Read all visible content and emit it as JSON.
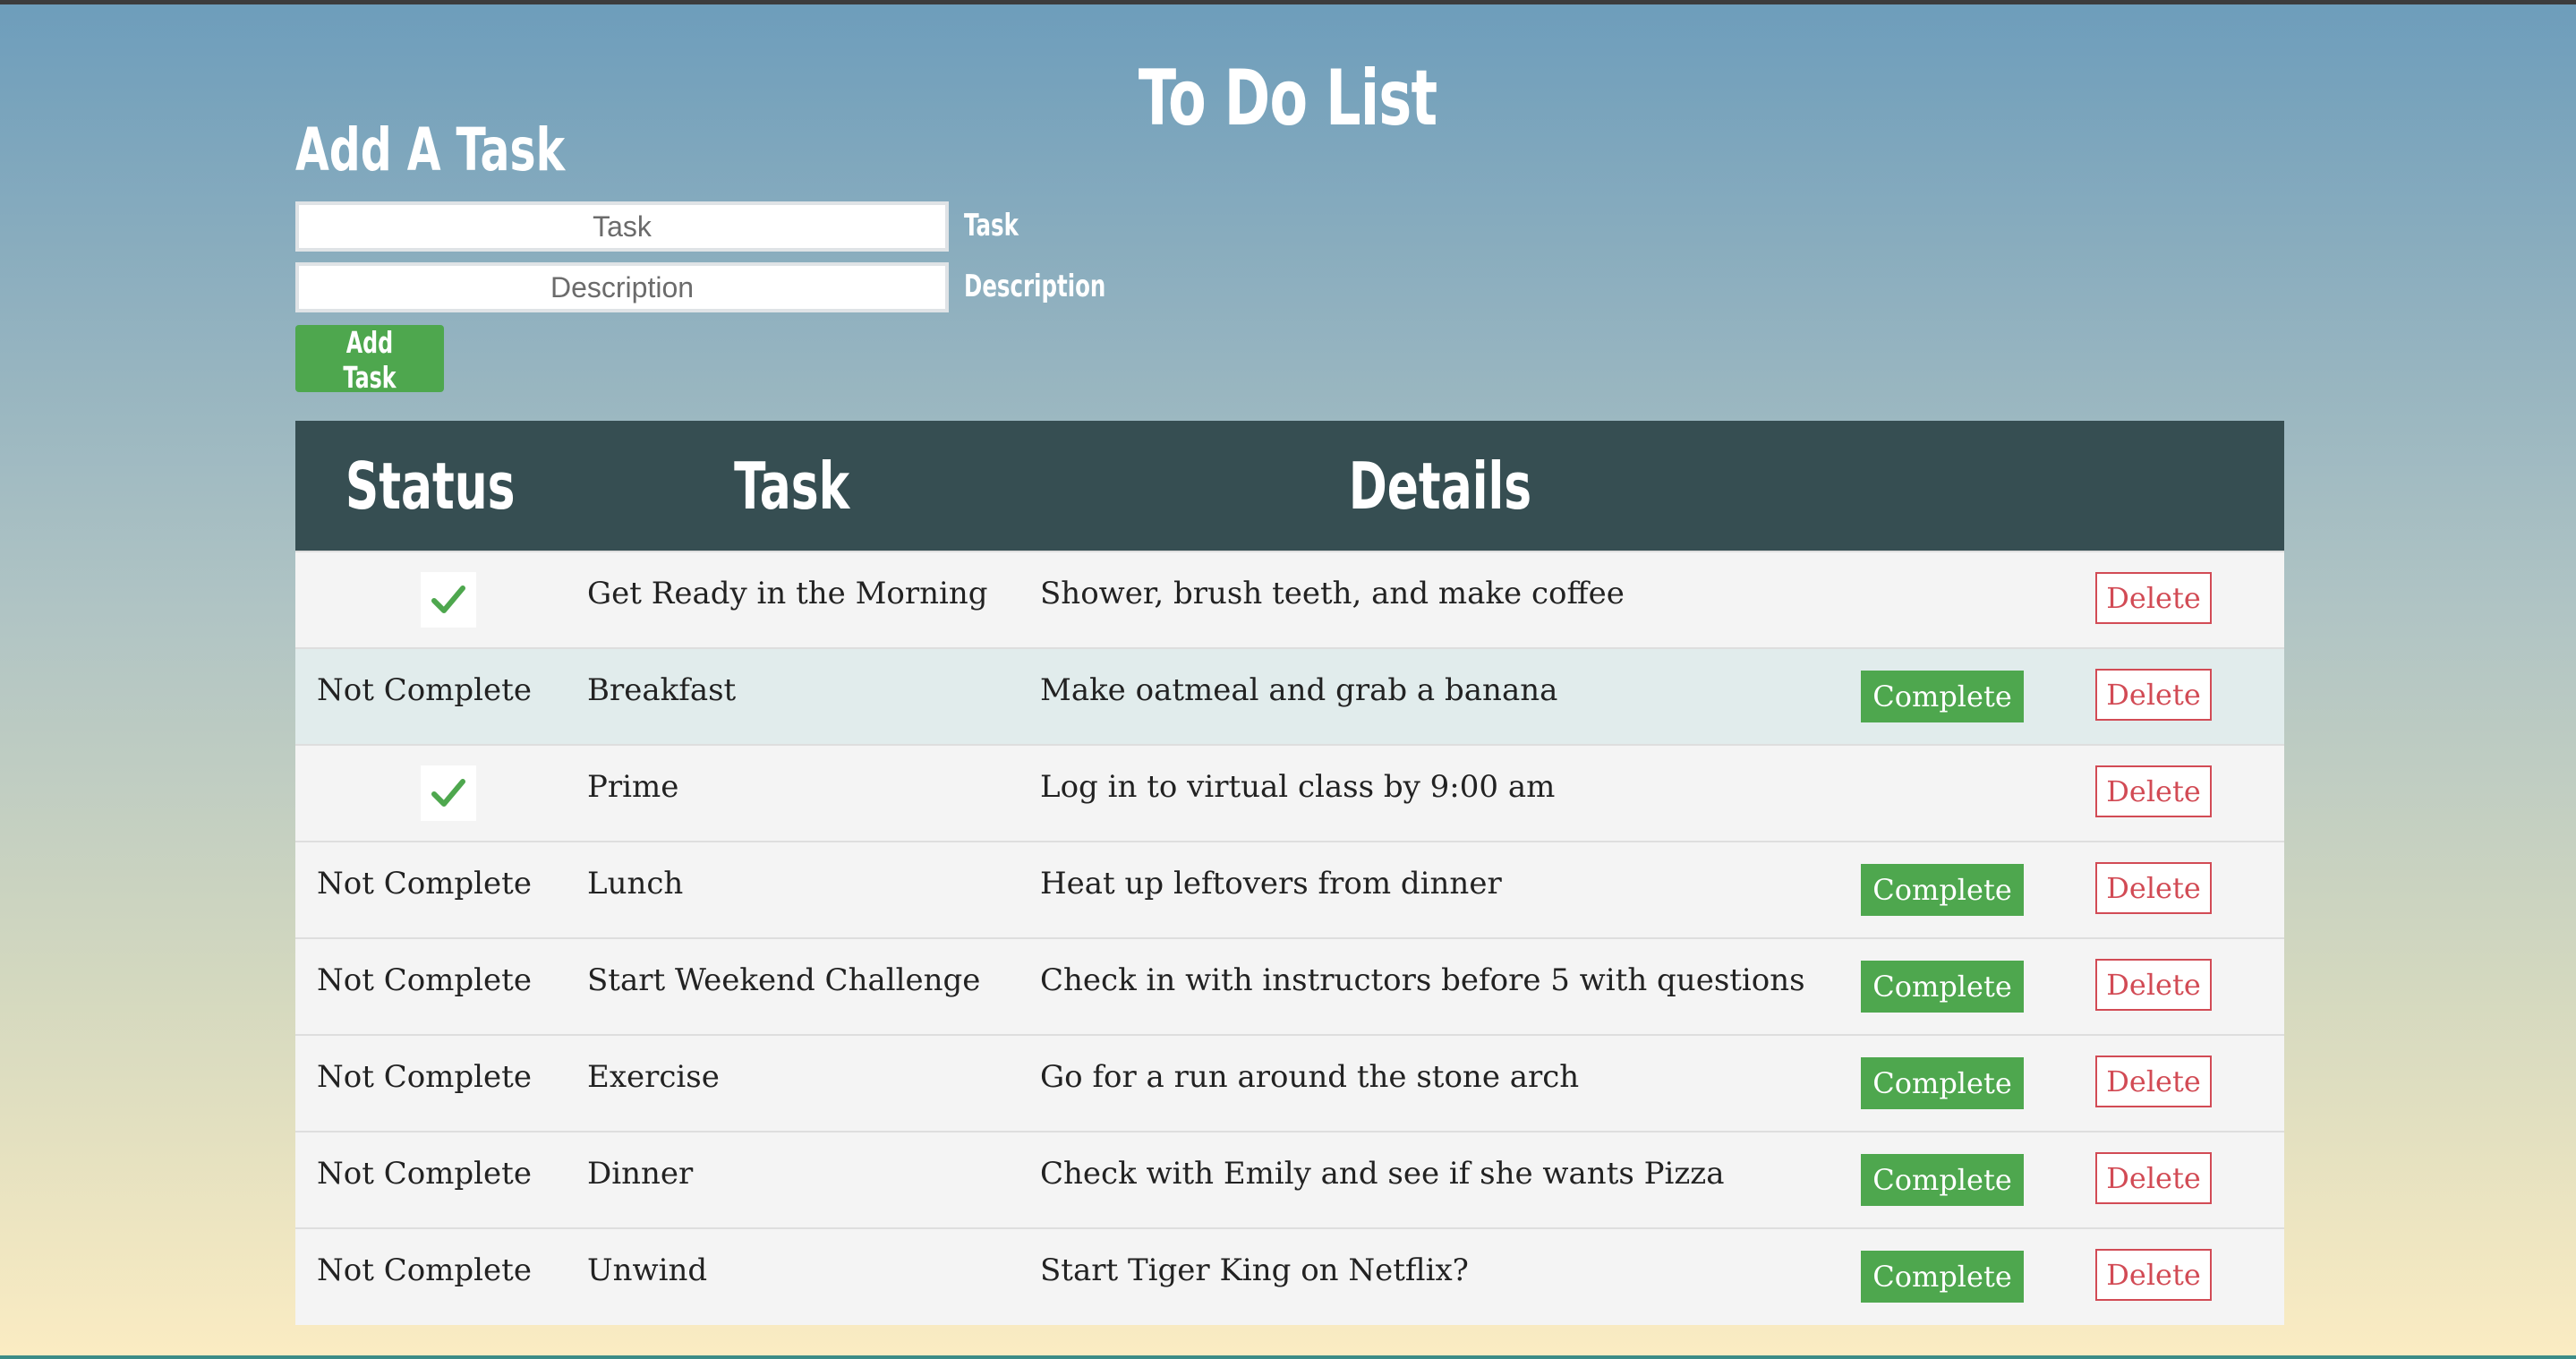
{
  "page": {
    "title": "To Do List"
  },
  "form": {
    "heading": "Add A Task",
    "task_placeholder": "Task",
    "description_placeholder": "Description",
    "task_label": "Task",
    "description_label": "Description",
    "submit_label": "Add Task"
  },
  "table": {
    "headers": {
      "status": "Status",
      "task": "Task",
      "details": "Details"
    },
    "rows": [
      {
        "status": "",
        "completed": true,
        "task": "Get Ready in the Morning",
        "details": "Shower, brush teeth, and make coffee",
        "complete_label": "",
        "delete_label": "Delete"
      },
      {
        "status": "Not Complete",
        "completed": false,
        "task": "Breakfast",
        "details": "Make oatmeal and grab a banana",
        "complete_label": "Complete",
        "delete_label": "Delete"
      },
      {
        "status": "",
        "completed": true,
        "task": "Prime",
        "details": "Log in to virtual class by 9:00 am",
        "complete_label": "",
        "delete_label": "Delete"
      },
      {
        "status": "Not Complete",
        "completed": false,
        "task": "Lunch",
        "details": "Heat up leftovers from dinner",
        "complete_label": "Complete",
        "delete_label": "Delete"
      },
      {
        "status": "Not Complete",
        "completed": false,
        "task": "Start Weekend Challenge",
        "details": "Check in with instructors before 5 with questions",
        "complete_label": "Complete",
        "delete_label": "Delete"
      },
      {
        "status": "Not Complete",
        "completed": false,
        "task": "Exercise",
        "details": "Go for a run around the stone arch",
        "complete_label": "Complete",
        "delete_label": "Delete"
      },
      {
        "status": "Not Complete",
        "completed": false,
        "task": "Dinner",
        "details": "Check with Emily and see if she wants Pizza",
        "complete_label": "Complete",
        "delete_label": "Delete"
      },
      {
        "status": "Not Complete",
        "completed": false,
        "task": "Unwind",
        "details": "Start Tiger King on Netflix?",
        "complete_label": "Complete",
        "delete_label": "Delete"
      }
    ]
  },
  "icons": {
    "completed_status": "check-icon"
  },
  "colors": {
    "header_bg": "#364e52",
    "complete_button": "#4ea74e",
    "delete_button": "#d24b55",
    "highlight_row": "#e1ecec"
  }
}
